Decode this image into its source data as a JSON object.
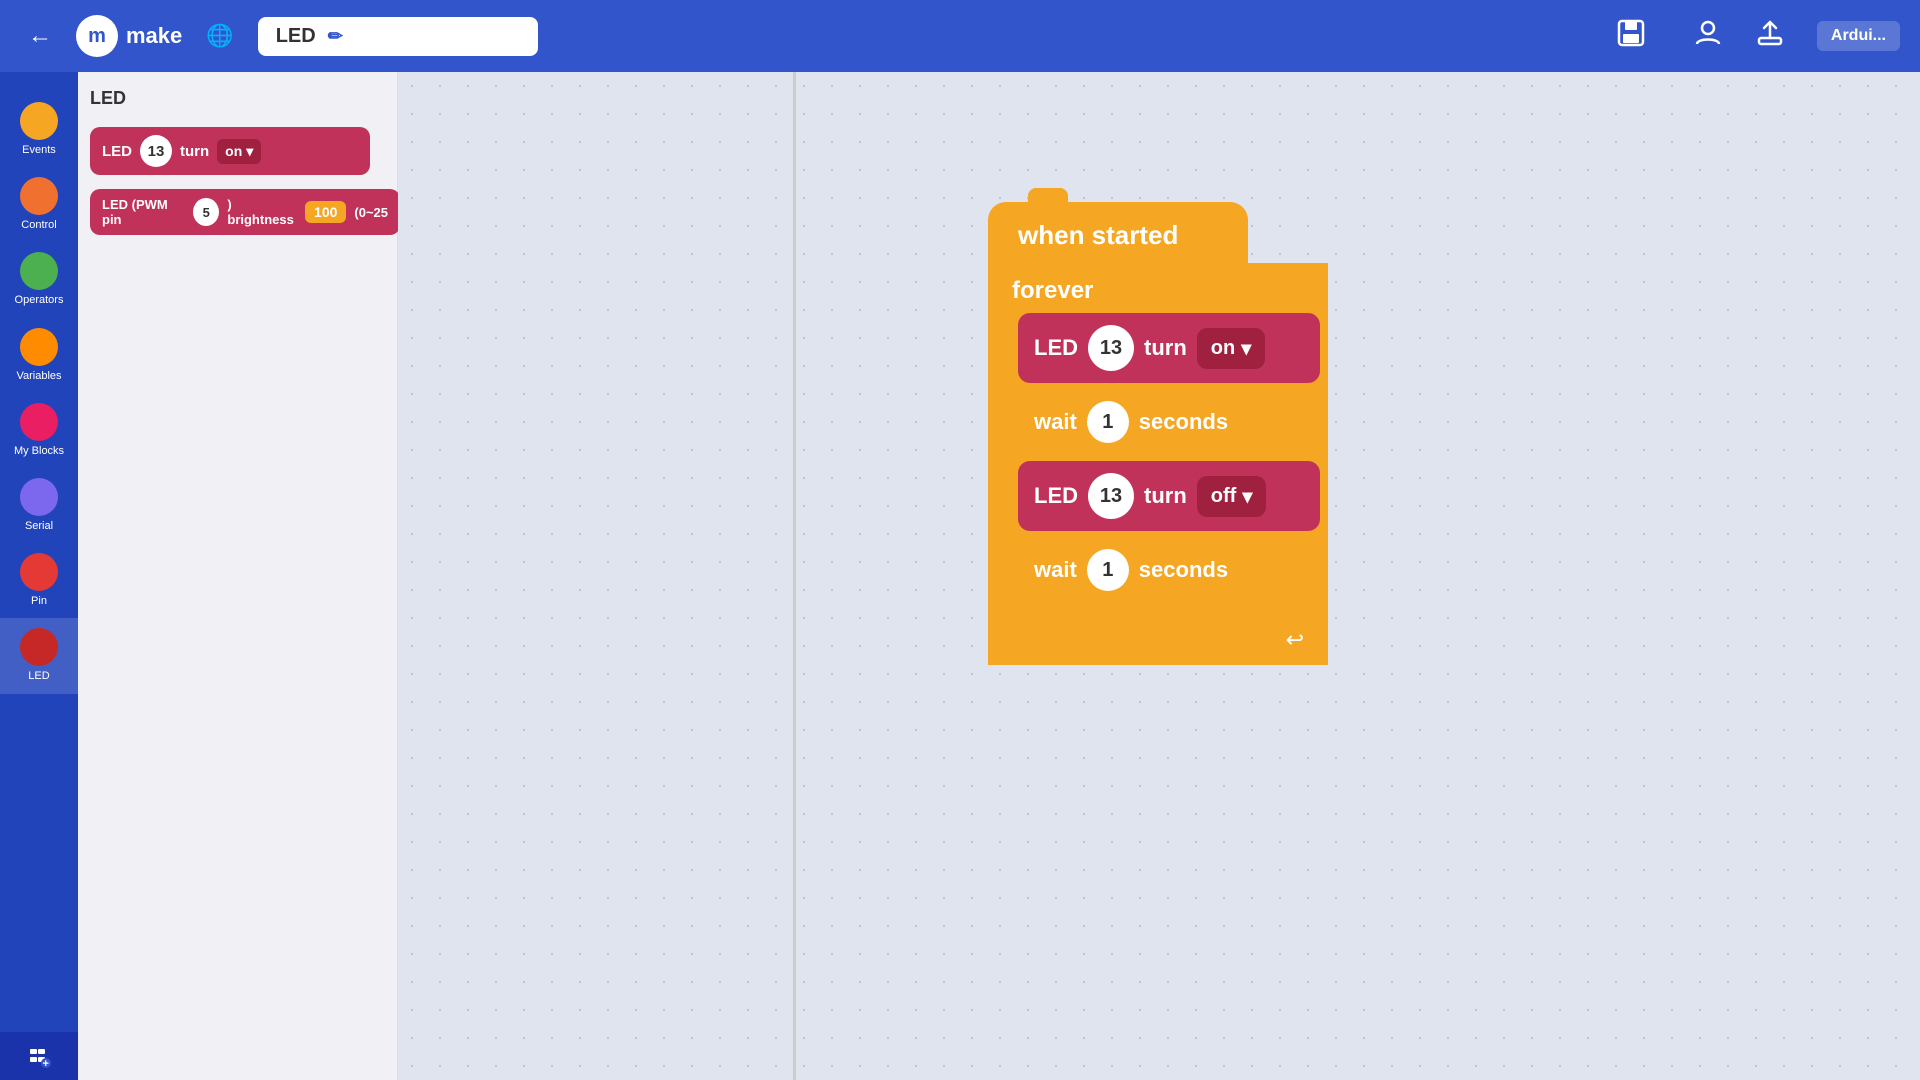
{
  "header": {
    "back_icon": "←",
    "logo_letter": "m",
    "logo_text": "make",
    "globe_icon": "🌐",
    "title": "LED",
    "pencil_icon": "✏",
    "save_icon": "💾",
    "user_icon": "👤",
    "upload_icon": "⬆",
    "arduino_label": "Ardui..."
  },
  "sidebar": {
    "items": [
      {
        "label": "Events",
        "color": "color-yellow"
      },
      {
        "label": "Control",
        "color": "color-orange"
      },
      {
        "label": "Operators",
        "color": "color-green"
      },
      {
        "label": "Variables",
        "color": "color-orange2"
      },
      {
        "label": "My Blocks",
        "color": "color-pink"
      },
      {
        "label": "Serial",
        "color": "color-purple"
      },
      {
        "label": "Pin",
        "color": "color-red"
      },
      {
        "label": "LED",
        "color": "color-darkred",
        "active": true
      }
    ],
    "add_btn": "+"
  },
  "block_panel": {
    "title": "LED",
    "led_on_block": {
      "prefix": "LED",
      "pin_num": "13",
      "turn_label": "turn",
      "state_label": "on",
      "dropdown_icon": "▾"
    },
    "led_pwm_block": {
      "prefix": "LED (PWM pin",
      "pin_num": "5",
      "suffix": ") brightness",
      "brightness_num": "100",
      "range": "(0~25"
    }
  },
  "canvas": {
    "when_started": {
      "label": "when started"
    },
    "forever": {
      "label": "forever",
      "loop_icon": "↩"
    },
    "led_on_block": {
      "prefix": "LED",
      "pin": "13",
      "turn": "turn",
      "state": "on",
      "dropdown": "▾"
    },
    "wait1_block": {
      "wait": "wait",
      "seconds_num": "1",
      "seconds": "seconds"
    },
    "led_off_block": {
      "prefix": "LED",
      "pin": "13",
      "turn": "turn",
      "state": "off",
      "dropdown": "▾"
    },
    "wait2_block": {
      "wait": "wait",
      "seconds_num": "1",
      "seconds": "seconds"
    }
  }
}
